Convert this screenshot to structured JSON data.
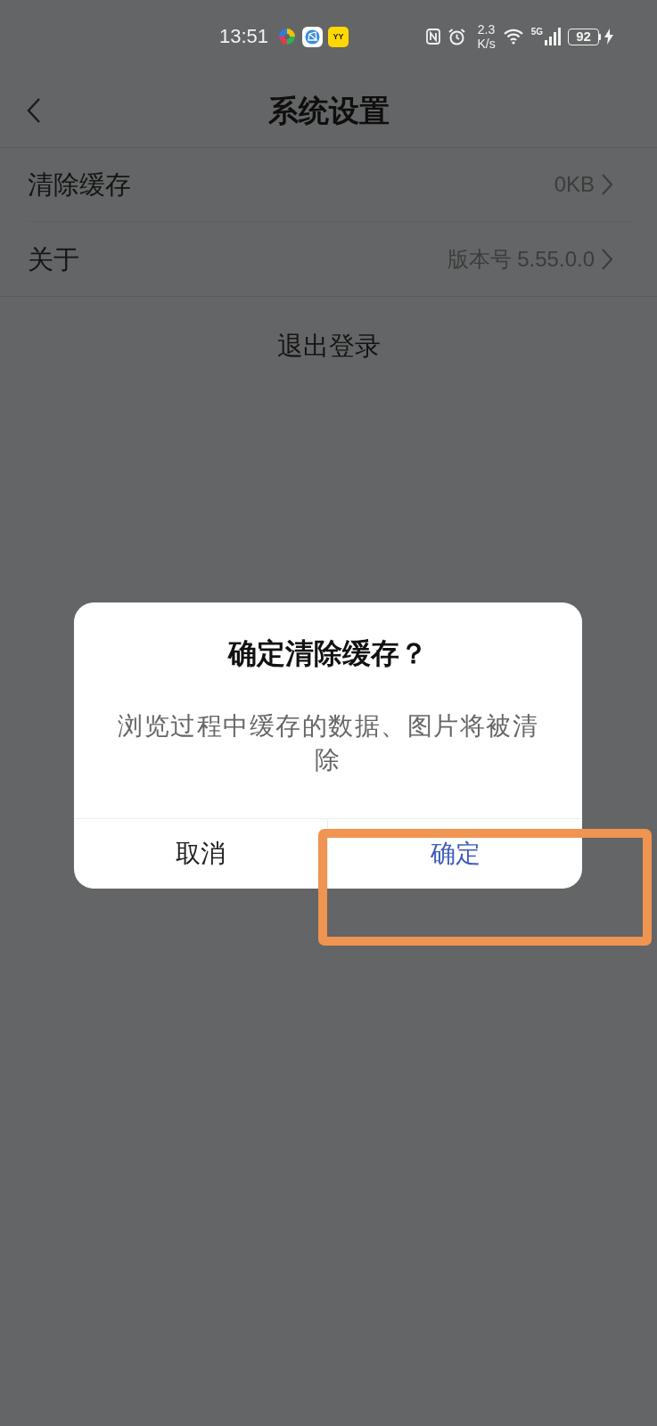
{
  "status_bar": {
    "time": "13:51",
    "apps": [
      {
        "kind": "pinwheel"
      },
      {
        "kind": "globe"
      },
      {
        "kind": "tile",
        "label": "YY"
      }
    ],
    "speed_value": "2.3",
    "speed_unit": "K/s",
    "network_type": "5G",
    "battery": "92"
  },
  "header": {
    "title": "系统设置"
  },
  "settings": [
    {
      "label": "清除缓存",
      "value": "0KB"
    },
    {
      "label": "关于",
      "value": "版本号 5.55.0.0"
    }
  ],
  "logout": {
    "label": "退出登录"
  },
  "dialog": {
    "title": "确定清除缓存？",
    "message": "浏览过程中缓存的数据、图片将被清除",
    "buttons": [
      {
        "label": "取消",
        "kind": "cancel"
      },
      {
        "label": "确定",
        "kind": "confirm"
      }
    ]
  }
}
